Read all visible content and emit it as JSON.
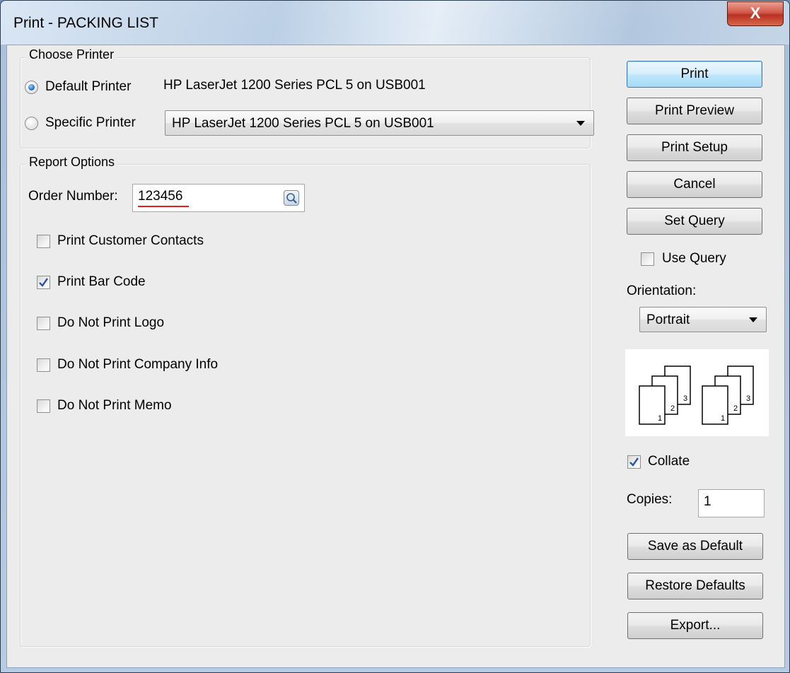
{
  "window": {
    "title": "Print - PACKING LIST",
    "close_label": "X"
  },
  "choose_printer": {
    "group_label": "Choose Printer",
    "default_label": "Default Printer",
    "default_value": "HP LaserJet 1200 Series PCL 5 on USB001",
    "specific_label": "Specific Printer",
    "specific_value": "HP LaserJet 1200 Series PCL 5 on USB001",
    "selected": "default"
  },
  "report_options": {
    "group_label": "Report Options",
    "order_number_label": "Order Number:",
    "order_number_value": "123456",
    "checkboxes": [
      {
        "label": "Print Customer Contacts",
        "checked": false
      },
      {
        "label": "Print Bar Code",
        "checked": true
      },
      {
        "label": "Do Not Print Logo",
        "checked": false
      },
      {
        "label": "Do Not Print Company Info",
        "checked": false
      },
      {
        "label": "Do Not Print Memo",
        "checked": false
      }
    ]
  },
  "side": {
    "print_label": "Print",
    "print_preview_label": "Print Preview",
    "print_setup_label": "Print Setup",
    "cancel_label": "Cancel",
    "set_query_label": "Set Query",
    "use_query_label": "Use Query",
    "use_query_checked": false,
    "orientation_label": "Orientation:",
    "orientation_value": "Portrait",
    "collate_label": "Collate",
    "collate_checked": true,
    "copies_label": "Copies:",
    "copies_value": "1",
    "save_default_label": "Save as Default",
    "restore_defaults_label": "Restore Defaults",
    "export_label": "Export...",
    "collate_pages": [
      "1",
      "2",
      "3"
    ]
  }
}
